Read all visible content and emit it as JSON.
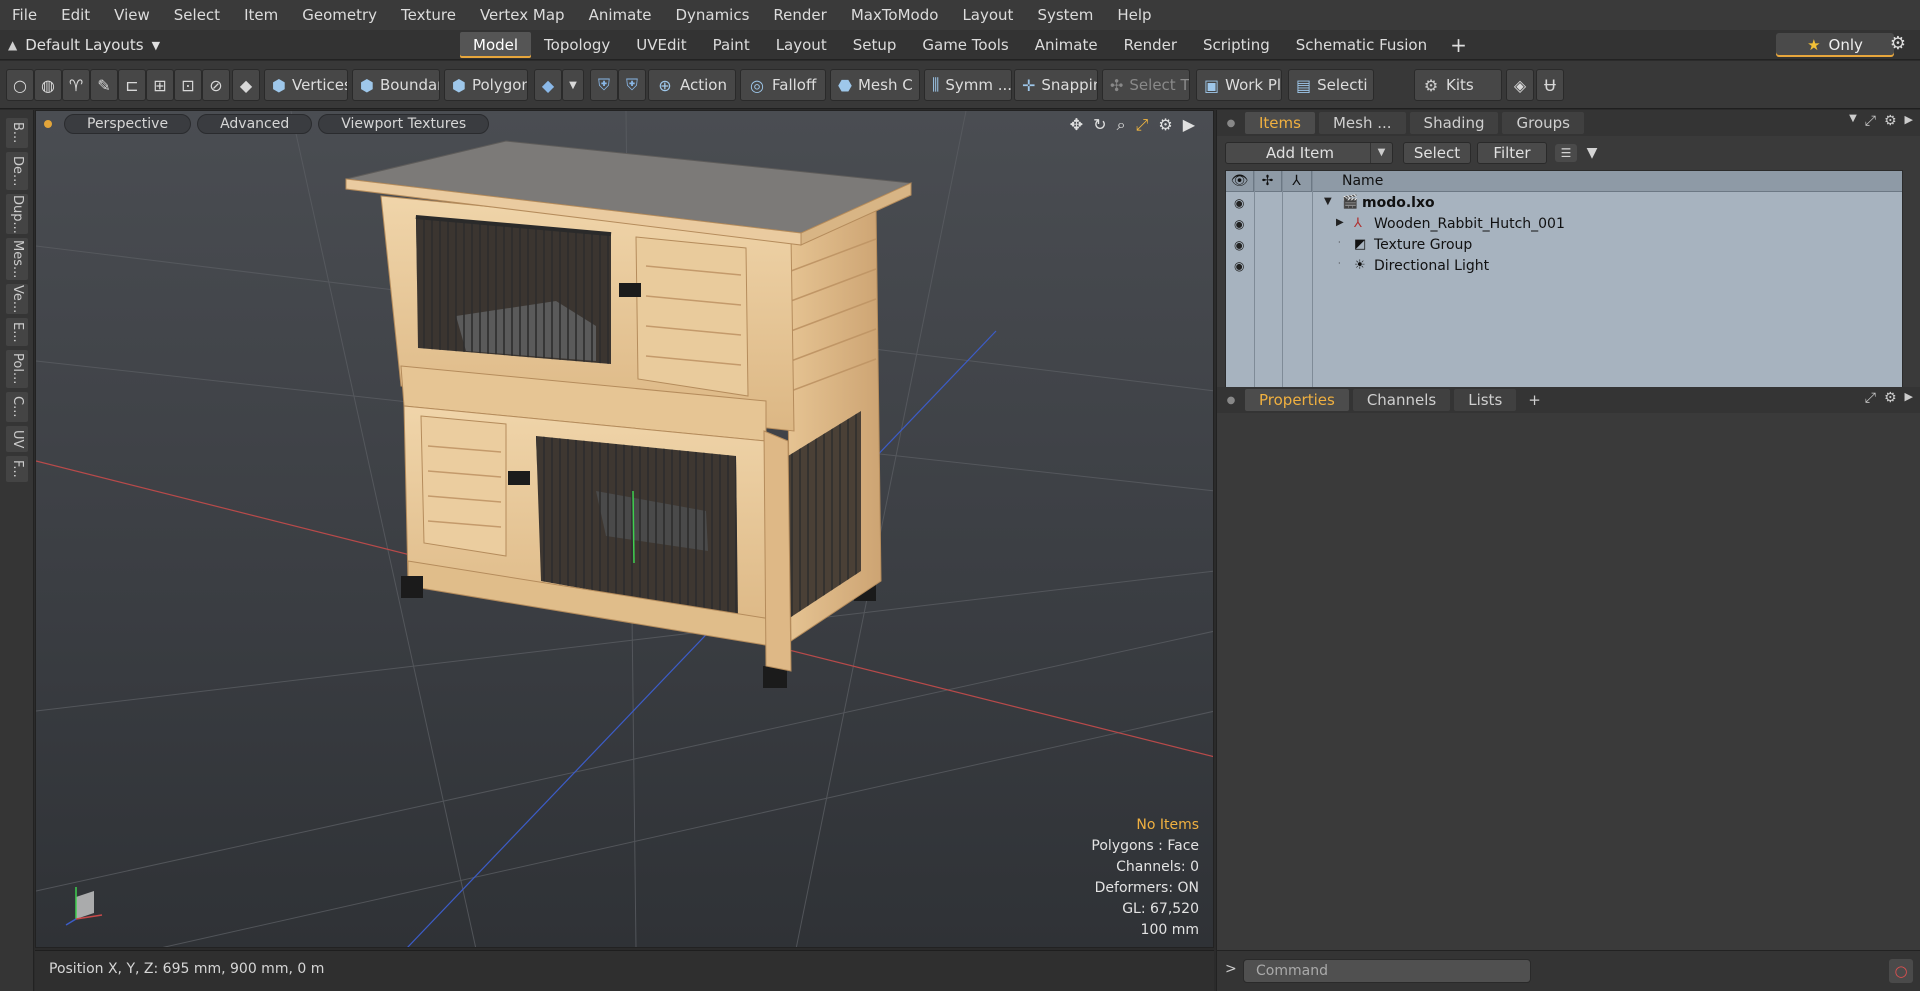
{
  "menubar": {
    "items": [
      "File",
      "Edit",
      "View",
      "Select",
      "Item",
      "Geometry",
      "Texture",
      "Vertex Map",
      "Animate",
      "Dynamics",
      "Render",
      "MaxToModo",
      "Layout",
      "System",
      "Help"
    ]
  },
  "layout": {
    "current": "Default Layouts",
    "tabs": [
      "Model",
      "Topology",
      "UVEdit",
      "Paint",
      "Layout",
      "Setup",
      "Game Tools",
      "Animate",
      "Render",
      "Scripting",
      "Schematic Fusion"
    ],
    "active_tab": "Model",
    "only_label": "Only"
  },
  "toolbar": {
    "vertices": "Vertices",
    "boundary": "Boundary",
    "polygons": "Polygons",
    "action": "Action",
    "falloff": "Falloff",
    "mesh_c": "Mesh C ...",
    "symm": "Symm ...",
    "snapping": "Snapping",
    "select_t": "Select T...",
    "work_pl": "Work Pl...",
    "selecti": "Selecti ...",
    "kits": "Kits"
  },
  "leftstrip": {
    "tabs": [
      "B...",
      "De...",
      "Dup...",
      "Mes...",
      "Ve...",
      "E...",
      "Pol...",
      "C...",
      "UV",
      "F..."
    ]
  },
  "viewport": {
    "buttons": [
      "Perspective",
      "Advanced",
      "Viewport Textures"
    ],
    "info": {
      "no_items": "No Items",
      "polygons": "Polygons : Face",
      "channels": "Channels: 0",
      "deformers": "Deformers: ON",
      "gl": "GL: 67,520",
      "scale": "100 mm"
    }
  },
  "status": {
    "position": "Position X, Y, Z:  695 mm, 900 mm, 0 m"
  },
  "items_panel": {
    "tabs": [
      "Items",
      "Mesh ...",
      "Shading",
      "Groups"
    ],
    "active_tab": "Items",
    "add_item": "Add Item",
    "select": "Select",
    "filter": "Filter",
    "column_name": "Name",
    "rows": [
      {
        "name": "modo.lxo",
        "icon": "scene-icon"
      },
      {
        "name": "Wooden_Rabbit_Hutch_001",
        "icon": "mesh-locator-icon"
      },
      {
        "name": "Texture Group",
        "icon": "texture-group-icon"
      },
      {
        "name": "Directional Light",
        "icon": "light-icon"
      }
    ]
  },
  "properties_panel": {
    "tabs": [
      "Properties",
      "Channels",
      "Lists"
    ],
    "active_tab": "Properties"
  },
  "command": {
    "placeholder": "Command"
  },
  "colors": {
    "accent": "#f0b040",
    "grid_x_axis": "#b84a4a",
    "grid_z_axis": "#3c5cc8",
    "grid_y_axis": "#3fcf4f",
    "wood": "#e8c99c"
  }
}
